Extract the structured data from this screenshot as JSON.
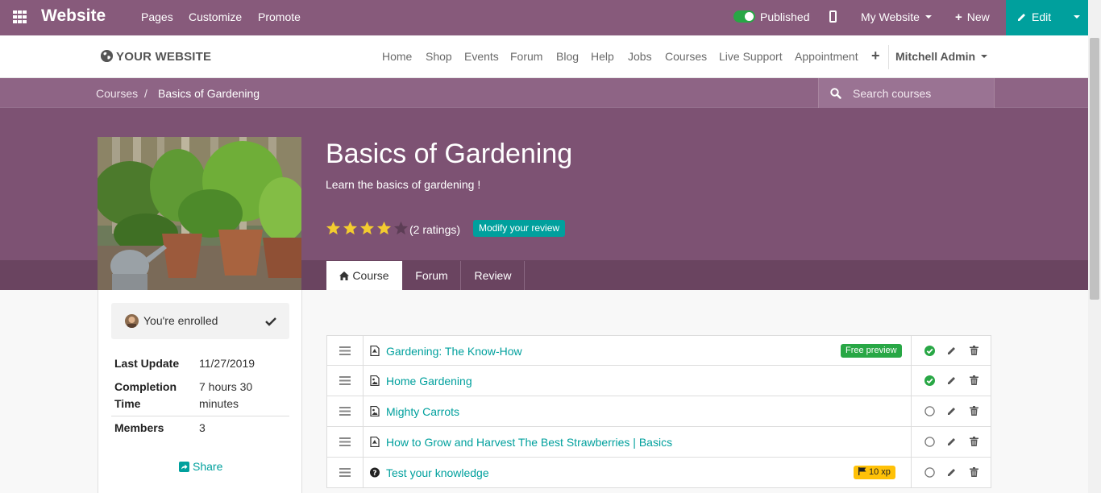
{
  "topbar": {
    "app_name": "Website",
    "menus": [
      "Pages",
      "Customize",
      "Promote"
    ],
    "published_label": "Published",
    "website_selector": "My Website",
    "new_label": "New",
    "edit_label": "Edit",
    "publish_color": "#28a745",
    "bar_color": "#875a7b",
    "edit_color": "#00a09d"
  },
  "site_nav": {
    "logo_text": "YOUR WEBSITE",
    "links": [
      "Home",
      "Shop",
      "Events",
      "Forum",
      "Blog",
      "Help",
      "Jobs",
      "Courses",
      "Live Support",
      "Appointment"
    ],
    "user": "Mitchell Admin"
  },
  "breadcrumb": {
    "parent": "Courses",
    "separator": "/",
    "current": "Basics of Gardening"
  },
  "search": {
    "placeholder": "Search courses"
  },
  "course": {
    "title": "Basics of Gardening",
    "description": "Learn the basics of gardening !",
    "rating": 4,
    "rating_max": 5,
    "ratings_text": "(2 ratings)",
    "modify_review_label": "Modify your review"
  },
  "tabs": [
    "Course",
    "Forum",
    "Review"
  ],
  "sidebar": {
    "enrolled_text": "You're enrolled",
    "meta": [
      {
        "label": "Last Update",
        "value": "11/27/2019"
      },
      {
        "label": "Completion Time",
        "value": "7 hours 30 minutes"
      },
      {
        "label": "Members",
        "value": "3"
      }
    ],
    "share_label": "Share"
  },
  "slides": [
    {
      "name": "Gardening: The Know-How",
      "type": "pdf",
      "badge": "Free preview",
      "done": true
    },
    {
      "name": "Home Gardening",
      "type": "image",
      "badge": "",
      "done": true
    },
    {
      "name": "Mighty Carrots",
      "type": "image",
      "badge": "",
      "done": false
    },
    {
      "name": "How to Grow and Harvest The Best Strawberries | Basics",
      "type": "pdf",
      "badge": "",
      "done": false
    },
    {
      "name": "Test your knowledge",
      "type": "quiz",
      "badge": "10 xp",
      "done": false
    }
  ]
}
